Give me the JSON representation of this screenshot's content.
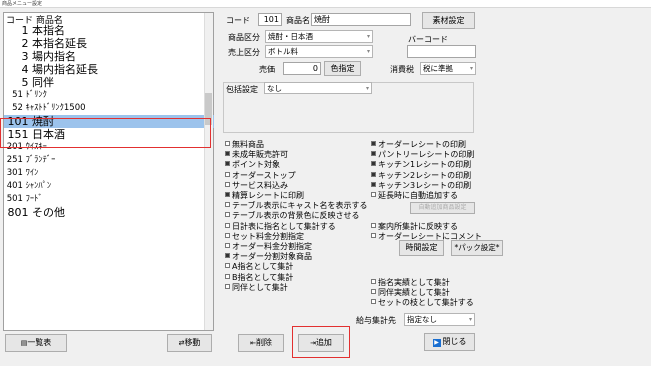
{
  "window_title": "商品メニュー設定",
  "list": {
    "header": "コード 商品名",
    "items": [
      {
        "code": "1",
        "name": "本指名"
      },
      {
        "code": "2",
        "name": "本指名延長"
      },
      {
        "code": "3",
        "name": "場内指名"
      },
      {
        "code": "4",
        "name": "場内指名延長"
      },
      {
        "code": "5",
        "name": "同伴"
      },
      {
        "code": "51",
        "name": "ﾄﾞﾘﾝｸ"
      },
      {
        "code": "52",
        "name": "ｷｬｽﾄﾄﾞﾘﾝｸ1500"
      },
      {
        "code": "101",
        "name": "焼酎",
        "selected": true
      },
      {
        "code": "151",
        "name": "日本酒"
      },
      {
        "code": "201",
        "name": "ｳｲｽｷｰ"
      },
      {
        "code": "251",
        "name": "ﾌﾞﾗﾝﾃﾞｰ"
      },
      {
        "code": "301",
        "name": "ﾜｲﾝ"
      },
      {
        "code": "401",
        "name": "ｼｬﾝﾊﾟﾝ"
      },
      {
        "code": "501",
        "name": "ﾌｰﾄﾞ"
      },
      {
        "code": "801",
        "name": "その他"
      }
    ]
  },
  "form": {
    "code_label": "コード",
    "code_value": "101",
    "name_label": "商品名",
    "name_value": "焼酎",
    "material_button": "素材設定",
    "category_label": "商品区分",
    "category_value": "焼酎・日本酒",
    "barcode_label": "バーコード",
    "barcode_value": "",
    "sales_category_label": "売上区分",
    "sales_category_value": "ボトル料",
    "price_label": "売価",
    "price_value": "0",
    "color_button": "色指定",
    "tax_label": "消費税",
    "tax_value": "税に準拠",
    "wrap_label": "包括設定",
    "wrap_value": "なし"
  },
  "checks_left": [
    {
      "label": "無料商品",
      "checked": false
    },
    {
      "label": "未成年販売許可",
      "checked": true
    },
    {
      "label": "ポイント対象",
      "checked": true
    },
    {
      "label": "オーダーストップ",
      "checked": false
    },
    {
      "label": "サービス料込み",
      "checked": false
    },
    {
      "label": "精算レシートに印刷",
      "checked": true
    },
    {
      "label": "テーブル表示にキャスト名を表示する",
      "checked": false
    },
    {
      "label": "テーブル表示の背景色に反映させる",
      "checked": false
    },
    {
      "label": "日計表に指名として集計する",
      "checked": false
    },
    {
      "label": "セット料金分割指定",
      "checked": false
    },
    {
      "label": "オーダー料金分割指定",
      "checked": false
    },
    {
      "label": "オーダー分割対象商品",
      "checked": true
    },
    {
      "label": "A指名として集計",
      "checked": false
    },
    {
      "label": "B指名として集計",
      "checked": false
    },
    {
      "label": "同伴として集計",
      "checked": false
    }
  ],
  "checks_right_top": [
    {
      "label": "オーダーレシートの印刷",
      "checked": true
    },
    {
      "label": "パントリーレシートの印刷",
      "checked": true
    },
    {
      "label": "キッチン1レシートの印刷",
      "checked": true
    },
    {
      "label": "キッチン2レシートの印刷",
      "checked": true
    },
    {
      "label": "キッチン3レシートの印刷",
      "checked": true
    },
    {
      "label": "延長時に自動追加する",
      "checked": false
    }
  ],
  "auto_add_button": "自動追加商品設定",
  "checks_right_mid": [
    {
      "label": "案内所集計に反映する",
      "checked": false
    },
    {
      "label": "オーダーレシートにコメント",
      "checked": false
    }
  ],
  "time_setting_button": "時間設定",
  "pack_setting_button": "*パック設定*",
  "checks_right_bottom": [
    {
      "label": "指名実績として集計",
      "checked": false
    },
    {
      "label": "同伴実績として集計",
      "checked": false
    },
    {
      "label": "セットの枝として集計する",
      "checked": false
    }
  ],
  "salary": {
    "label": "給与集計先",
    "value": "指定なし"
  },
  "buttons": {
    "list_view": "一覧表",
    "move": "移動",
    "delete": "削除",
    "add": "追加",
    "close": "閉じる"
  },
  "colors": {
    "selection": "#9cc3ec",
    "highlight_box": "#e23030",
    "close_icon": "#1a6fd1"
  }
}
